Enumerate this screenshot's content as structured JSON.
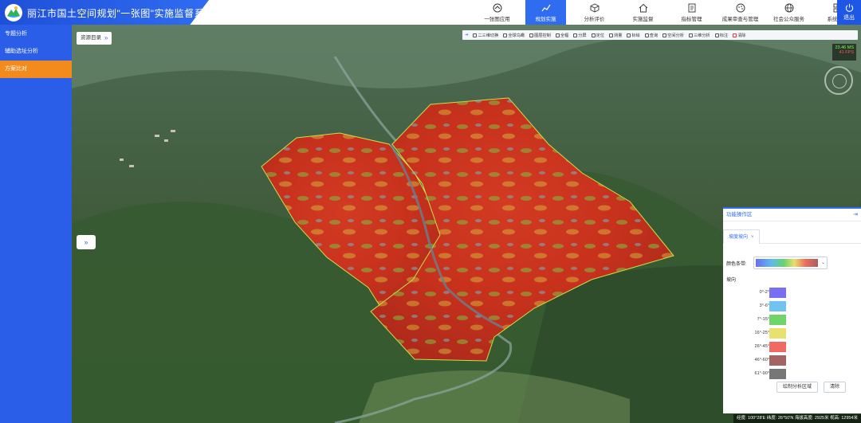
{
  "app": {
    "title": "丽江市国土空间规划\"一张图\"实施监督系统"
  },
  "nav": [
    {
      "label": "一张图应用",
      "icon": "home-icon"
    },
    {
      "label": "规划实施",
      "icon": "chart-icon"
    },
    {
      "label": "分析评价",
      "icon": "cube-icon"
    },
    {
      "label": "实施监督",
      "icon": "house-icon"
    },
    {
      "label": "指标管理",
      "icon": "document-icon"
    },
    {
      "label": "成果审查与管理",
      "icon": "palette-icon"
    },
    {
      "label": "社会公众服务",
      "icon": "globe-icon"
    },
    {
      "label": "系统管理",
      "icon": "grid-icon"
    }
  ],
  "exit": {
    "label": "退出"
  },
  "sidebar": {
    "items": [
      {
        "label": "专题分析"
      },
      {
        "label": "辅助选址分析"
      },
      {
        "label": "方案比对"
      }
    ]
  },
  "map": {
    "resource_catalog": "资源目录",
    "expand": "»",
    "fps": {
      "ms": "23.46 MS",
      "frames": "41 FPS"
    },
    "status": "经度: 100°28'E 纬度: 26°50'N 海拔高度: 2925米 视高: 12954米"
  },
  "toolbar": {
    "items": [
      {
        "label": "二三维切换"
      },
      {
        "label": "全球鸟瞰"
      },
      {
        "label": "图层控制"
      },
      {
        "label": "全幅"
      },
      {
        "label": "分屏"
      },
      {
        "label": "定位"
      },
      {
        "label": "测量"
      },
      {
        "label": "标绘"
      },
      {
        "label": "查询"
      },
      {
        "label": "空间分析"
      },
      {
        "label": "三维分析"
      },
      {
        "label": "标注"
      },
      {
        "label": "清除"
      }
    ]
  },
  "panel": {
    "title": "功能操作区",
    "collapse": "⇥",
    "tab": "坡度坡向",
    "color_label": "颜色条带:",
    "slope_title": "坡向",
    "legend": [
      {
        "label": "0°-2°",
        "color": "#7a6ff0"
      },
      {
        "label": "3°-6°",
        "color": "#6fc3ee"
      },
      {
        "label": "7°-15°",
        "color": "#6fd56b"
      },
      {
        "label": "16°-25°",
        "color": "#e8e16e"
      },
      {
        "label": "26°-45°",
        "color": "#f16a62"
      },
      {
        "label": "46°-60°",
        "color": "#a46464"
      },
      {
        "label": "61°-90°",
        "color": "#777777"
      }
    ],
    "draw_button": "绘制分析区域",
    "clear_button": "清除"
  }
}
